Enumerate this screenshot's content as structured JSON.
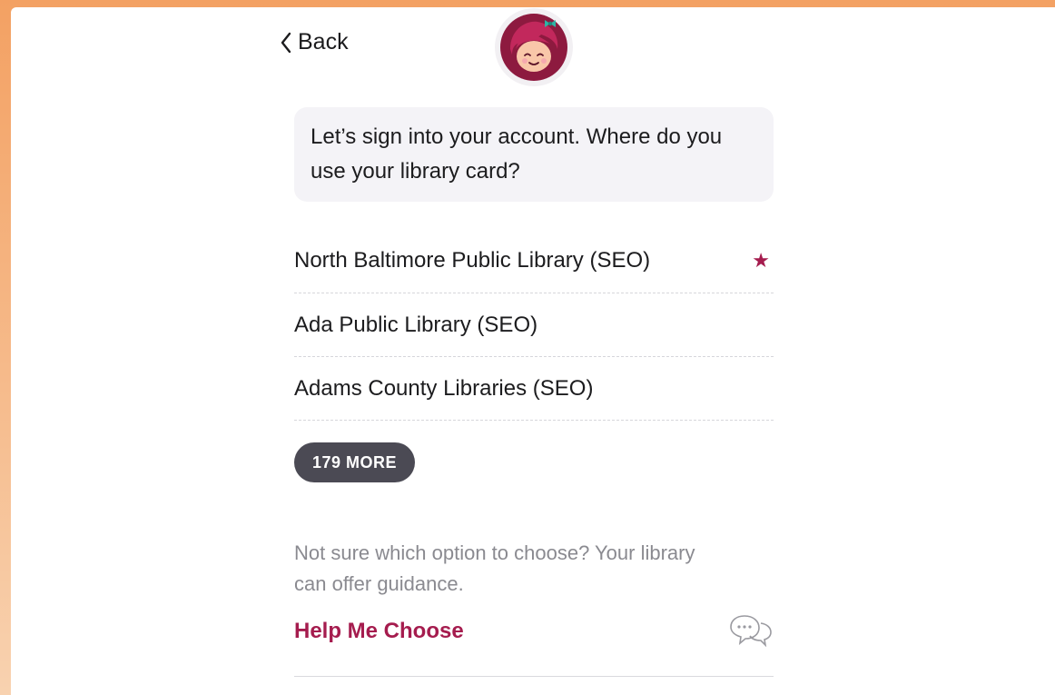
{
  "header": {
    "back_label": "Back",
    "logo_icon": "libby-logo-icon"
  },
  "prompt": {
    "text": "Let’s sign into your account. Where do you use your library card?"
  },
  "libraries": [
    {
      "name": "North Baltimore Public Library (SEO)",
      "starred": true
    },
    {
      "name": "Ada Public Library (SEO)",
      "starred": false
    },
    {
      "name": "Adams County Libraries (SEO)",
      "starred": false
    }
  ],
  "more_button": {
    "label": "179 MORE"
  },
  "guidance": {
    "text": "Not sure which option to choose? Your library can offer guidance."
  },
  "help": {
    "label": "Help Me Choose",
    "icon": "chat-bubbles-icon"
  },
  "colors": {
    "accent": "#a51c4e",
    "button_bg": "#4b4a54",
    "prompt_bg": "#f4f3f7",
    "page_border": "#f3a163"
  }
}
